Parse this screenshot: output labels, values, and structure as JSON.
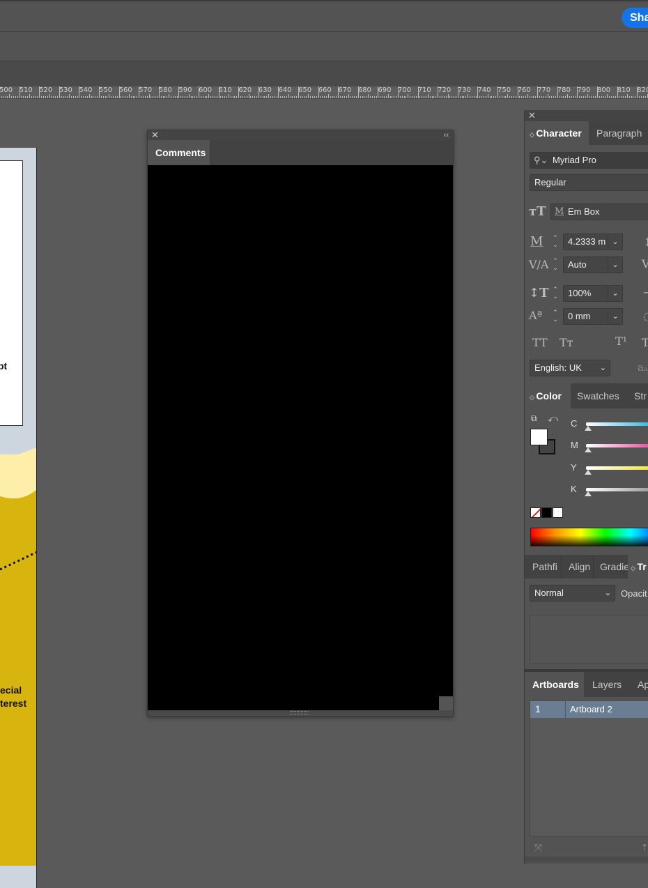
{
  "topbar": {
    "share_label": "Sha"
  },
  "ruler": {
    "ticks": [
      "500",
      "510",
      "520",
      "530",
      "540",
      "550",
      "560",
      "570",
      "580",
      "590",
      "600",
      "610",
      "620",
      "630",
      "640",
      "650",
      "660",
      "670",
      "680",
      "690",
      "700",
      "710",
      "720",
      "730",
      "740",
      "750",
      "760",
      "770",
      "780",
      "790",
      "800",
      "810",
      "820"
    ]
  },
  "artwork": {
    "text_lines": [
      "pt",
      "t",
      "ecial",
      "terest"
    ]
  },
  "comments_panel": {
    "tab_label": "Comments",
    "close_icon": "close-icon",
    "collapse_icon": "collapse-icon"
  },
  "character_panel": {
    "tabs": [
      "Character",
      "Paragraph"
    ],
    "font_family": "Myriad Pro",
    "font_style": "Regular",
    "em_box": "Em Box",
    "font_size": "4.2333 m",
    "kerning": "Auto",
    "vertical_scale": "100%",
    "baseline_shift": "0 mm",
    "language": "English: UK",
    "caps_labels": [
      "TT",
      "Tт",
      "T¹",
      "T"
    ]
  },
  "color_panel": {
    "tabs": [
      "Color",
      "Swatches",
      "Str"
    ],
    "channels": [
      {
        "name": "C",
        "value": 0,
        "color": "#2fb7e6"
      },
      {
        "name": "M",
        "value": 0,
        "color": "#e64ea0"
      },
      {
        "name": "Y",
        "value": 0,
        "color": "#f3e53a"
      },
      {
        "name": "K",
        "value": 0,
        "color": "#9a9a9a"
      }
    ]
  },
  "transparency_panel": {
    "tabs": [
      "Pathfi",
      "Align",
      "Gradie",
      "Tr"
    ],
    "blend_mode": "Normal",
    "opacity_label": "Opacit"
  },
  "artboards_panel": {
    "tabs": [
      "Artboards",
      "Layers",
      "Ap"
    ],
    "rows": [
      {
        "index": "1",
        "name": "Artboard 2"
      }
    ]
  }
}
